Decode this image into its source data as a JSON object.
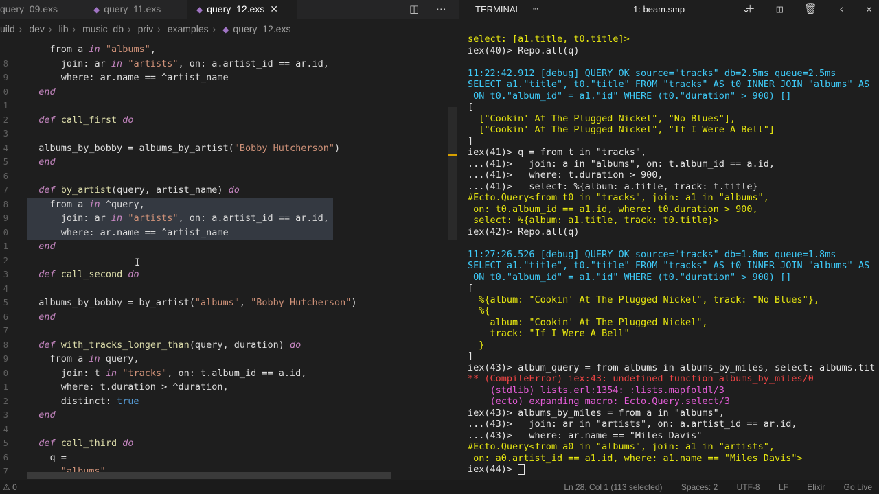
{
  "tabs": [
    {
      "label": "query_09.exs",
      "active": false
    },
    {
      "label": "query_11.exs",
      "active": false
    },
    {
      "label": "query_12.exs",
      "active": true
    }
  ],
  "breadcrumb": [
    "uild",
    "dev",
    "lib",
    "music_db",
    "priv",
    "examples",
    "query_12.exs"
  ],
  "editor": {
    "lines": [
      {
        "ln": "",
        "tokens": [
          [
            "    from a ",
            "var"
          ],
          [
            "in",
            "kw"
          ],
          [
            " ",
            "var"
          ],
          [
            "\"albums\"",
            "str"
          ],
          [
            ",",
            "var"
          ]
        ]
      },
      {
        "ln": "8",
        "tokens": [
          [
            "      join: ar ",
            "var"
          ],
          [
            "in",
            "kw"
          ],
          [
            " ",
            "var"
          ],
          [
            "\"artists\"",
            "str"
          ],
          [
            ", on: a.artist_id == ar.id,",
            "var"
          ]
        ]
      },
      {
        "ln": "9",
        "tokens": [
          [
            "      where: ar.name == ^artist_name",
            "var"
          ]
        ]
      },
      {
        "ln": "0",
        "tokens": [
          [
            "  ",
            "var"
          ],
          [
            "end",
            "kw"
          ]
        ]
      },
      {
        "ln": "1",
        "tokens": []
      },
      {
        "ln": "2",
        "tokens": [
          [
            "  ",
            "var"
          ],
          [
            "def",
            "kw"
          ],
          [
            " ",
            "var"
          ],
          [
            "call_first",
            "fn"
          ],
          [
            " ",
            "var"
          ],
          [
            "do",
            "kw"
          ]
        ]
      },
      {
        "ln": "3",
        "tokens": []
      },
      {
        "ln": "4",
        "tokens": [
          [
            "  albums_by_bobby = albums_by_artist(",
            "var"
          ],
          [
            "\"Bobby Hutcherson\"",
            "str"
          ],
          [
            ")",
            "var"
          ]
        ]
      },
      {
        "ln": "5",
        "tokens": [
          [
            "  ",
            "var"
          ],
          [
            "end",
            "kw"
          ]
        ]
      },
      {
        "ln": "6",
        "tokens": []
      },
      {
        "ln": "7",
        "tokens": [
          [
            "  ",
            "var"
          ],
          [
            "def",
            "kw"
          ],
          [
            " ",
            "var"
          ],
          [
            "by_artist",
            "fn"
          ],
          [
            "(query, artist_name) ",
            "var"
          ],
          [
            "do",
            "kw"
          ]
        ]
      },
      {
        "ln": "8",
        "tokens": [
          [
            "    from a ",
            "var"
          ],
          [
            "in",
            "kw"
          ],
          [
            " ^query,",
            "var"
          ]
        ],
        "sel": true
      },
      {
        "ln": "9",
        "tokens": [
          [
            "      join: ar ",
            "var"
          ],
          [
            "in",
            "kw"
          ],
          [
            " ",
            "var"
          ],
          [
            "\"artists\"",
            "str"
          ],
          [
            ", on: a.artist_id == ar.id,",
            "var"
          ]
        ],
        "sel": true
      },
      {
        "ln": "0",
        "tokens": [
          [
            "      where: ar.name == ^artist_name",
            "var"
          ]
        ],
        "sel": true
      },
      {
        "ln": "1",
        "tokens": [
          [
            "  ",
            "var"
          ],
          [
            "end",
            "kw"
          ]
        ]
      },
      {
        "ln": "2",
        "tokens": []
      },
      {
        "ln": "3",
        "tokens": [
          [
            "  ",
            "var"
          ],
          [
            "def",
            "kw"
          ],
          [
            " ",
            "var"
          ],
          [
            "call_second",
            "fn"
          ],
          [
            " ",
            "var"
          ],
          [
            "do",
            "kw"
          ]
        ]
      },
      {
        "ln": "4",
        "tokens": []
      },
      {
        "ln": "5",
        "tokens": [
          [
            "  albums_by_bobby = by_artist(",
            "var"
          ],
          [
            "\"albums\"",
            "str"
          ],
          [
            ", ",
            "var"
          ],
          [
            "\"Bobby Hutcherson\"",
            "str"
          ],
          [
            ")",
            "var"
          ]
        ]
      },
      {
        "ln": "6",
        "tokens": [
          [
            "  ",
            "var"
          ],
          [
            "end",
            "kw"
          ]
        ]
      },
      {
        "ln": "7",
        "tokens": []
      },
      {
        "ln": "8",
        "tokens": [
          [
            "  ",
            "var"
          ],
          [
            "def",
            "kw"
          ],
          [
            " ",
            "var"
          ],
          [
            "with_tracks_longer_than",
            "fn"
          ],
          [
            "(query, duration) ",
            "var"
          ],
          [
            "do",
            "kw"
          ]
        ]
      },
      {
        "ln": "9",
        "tokens": [
          [
            "    from a ",
            "var"
          ],
          [
            "in",
            "kw"
          ],
          [
            " query,",
            "var"
          ]
        ]
      },
      {
        "ln": "0",
        "tokens": [
          [
            "      join: t ",
            "var"
          ],
          [
            "in",
            "kw"
          ],
          [
            " ",
            "var"
          ],
          [
            "\"tracks\"",
            "str"
          ],
          [
            ", on: t.album_id == a.id,",
            "var"
          ]
        ]
      },
      {
        "ln": "1",
        "tokens": [
          [
            "      where: t.duration > ^duration,",
            "var"
          ]
        ]
      },
      {
        "ln": "2",
        "tokens": [
          [
            "      distinct: ",
            "var"
          ],
          [
            "true",
            "bool"
          ]
        ]
      },
      {
        "ln": "3",
        "tokens": [
          [
            "  ",
            "var"
          ],
          [
            "end",
            "kw"
          ]
        ]
      },
      {
        "ln": "4",
        "tokens": []
      },
      {
        "ln": "5",
        "tokens": [
          [
            "  ",
            "var"
          ],
          [
            "def",
            "kw"
          ],
          [
            " ",
            "var"
          ],
          [
            "call_third",
            "fn"
          ],
          [
            " ",
            "var"
          ],
          [
            "do",
            "kw"
          ]
        ]
      },
      {
        "ln": "6",
        "tokens": [
          [
            "    q =",
            "var"
          ]
        ]
      },
      {
        "ln": "7",
        "tokens": [
          [
            "      ",
            "var"
          ],
          [
            "\"albums\"",
            "str"
          ]
        ]
      }
    ]
  },
  "terminal": {
    "title": "TERMINAL",
    "selected_shell": "1: beam.smp",
    "lines": [
      {
        "t": "select: [a1.title, t0.title]>",
        "c": "yellow"
      },
      {
        "t": "iex(40)> Repo.all(q)",
        "c": "default"
      },
      {
        "t": "",
        "c": "default"
      },
      {
        "t": "11:22:42.912 [debug] QUERY OK source=\"tracks\" db=2.5ms queue=2.5ms",
        "c": "cyan"
      },
      {
        "t": "SELECT a1.\"title\", t0.\"title\" FROM \"tracks\" AS t0 INNER JOIN \"albums\" AS",
        "c": "cyan"
      },
      {
        "t": " ON t0.\"album_id\" = a1.\"id\" WHERE (t0.\"duration\" > 900) []",
        "c": "cyan"
      },
      {
        "t": "[",
        "c": "default"
      },
      {
        "t": "  [\"Cookin' At The Plugged Nickel\", \"No Blues\"],",
        "c": "yellow"
      },
      {
        "t": "  [\"Cookin' At The Plugged Nickel\", \"If I Were A Bell\"]",
        "c": "yellow"
      },
      {
        "t": "]",
        "c": "default"
      },
      {
        "t": "iex(41)> q = from t in \"tracks\",",
        "c": "default"
      },
      {
        "t": "...(41)>   join: a in \"albums\", on: t.album_id == a.id,",
        "c": "default"
      },
      {
        "t": "...(41)>   where: t.duration > 900,",
        "c": "default"
      },
      {
        "t": "...(41)>   select: %{album: a.title, track: t.title}",
        "c": "default"
      },
      {
        "t": "#Ecto.Query<from t0 in \"tracks\", join: a1 in \"albums\",",
        "c": "yellow"
      },
      {
        "t": " on: t0.album_id == a1.id, where: t0.duration > 900,",
        "c": "yellow"
      },
      {
        "t": " select: %{album: a1.title, track: t0.title}>",
        "c": "yellow"
      },
      {
        "t": "iex(42)> Repo.all(q)",
        "c": "default"
      },
      {
        "t": "",
        "c": "default"
      },
      {
        "t": "11:27:26.526 [debug] QUERY OK source=\"tracks\" db=1.8ms queue=1.8ms",
        "c": "cyan"
      },
      {
        "t": "SELECT a1.\"title\", t0.\"title\" FROM \"tracks\" AS t0 INNER JOIN \"albums\" AS",
        "c": "cyan"
      },
      {
        "t": " ON t0.\"album_id\" = a1.\"id\" WHERE (t0.\"duration\" > 900) []",
        "c": "cyan"
      },
      {
        "t": "[",
        "c": "default"
      },
      {
        "t": "  %{album: \"Cookin' At The Plugged Nickel\", track: \"No Blues\"},",
        "c": "yellow"
      },
      {
        "t": "  %{",
        "c": "yellow"
      },
      {
        "t": "    album: \"Cookin' At The Plugged Nickel\",",
        "c": "yellow"
      },
      {
        "t": "    track: \"If I Were A Bell\"",
        "c": "yellow"
      },
      {
        "t": "  }",
        "c": "yellow"
      },
      {
        "t": "]",
        "c": "default"
      },
      {
        "t": "iex(43)> album_query = from albums in albums_by_miles, select: albums.tit",
        "c": "default"
      },
      {
        "t": "** (CompileError) iex:43: undefined function albums_by_miles/0",
        "c": "red"
      },
      {
        "t": "    (stdlib) lists.erl:1354: :lists.mapfoldl/3",
        "c": "magenta"
      },
      {
        "t": "    (ecto) expanding macro: Ecto.Query.select/3",
        "c": "magenta"
      },
      {
        "t": "iex(43)> albums_by_miles = from a in \"albums\",",
        "c": "default"
      },
      {
        "t": "...(43)>   join: ar in \"artists\", on: a.artist_id == ar.id,",
        "c": "default"
      },
      {
        "t": "...(43)>   where: ar.name == \"Miles Davis\"",
        "c": "default"
      },
      {
        "t": "#Ecto.Query<from a0 in \"albums\", join: a1 in \"artists\",",
        "c": "yellow"
      },
      {
        "t": " on: a0.artist_id == a1.id, where: a1.name == \"Miles Davis\">",
        "c": "yellow"
      },
      {
        "t": "iex(44)> ",
        "c": "default",
        "cursor": true
      }
    ]
  },
  "statusbar": {
    "left": "⚠ 0",
    "position": "Ln 28, Col 1 (113 selected)",
    "spaces": "Spaces: 2",
    "encoding": "UTF-8",
    "eol": "LF",
    "language": "Elixir",
    "golive": "Go Live"
  },
  "colors": {
    "keyword": "#c586c0",
    "string": "#ce9178",
    "function": "#dcdcaa",
    "terminal_yellow": "#e5e510",
    "terminal_cyan": "#3ec9f6",
    "terminal_red": "#ee4444"
  }
}
